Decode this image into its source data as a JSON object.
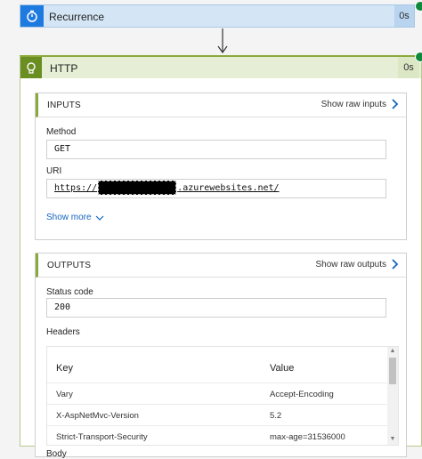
{
  "recurrence": {
    "title": "Recurrence",
    "duration": "0s",
    "icon": "stopwatch-icon"
  },
  "http": {
    "title": "HTTP",
    "duration": "0s",
    "icon": "globe-icon",
    "inputs": {
      "label": "INPUTS",
      "raw_link": "Show raw inputs",
      "method_label": "Method",
      "method_value": "GET",
      "uri_label": "URI",
      "uri_prefix": "https://",
      "uri_suffix": ".azurewebsites.net/",
      "show_more": "Show more"
    },
    "outputs": {
      "label": "OUTPUTS",
      "raw_link": "Show raw outputs",
      "status_label": "Status code",
      "status_value": "200",
      "headers_label": "Headers",
      "table": {
        "col_key": "Key",
        "col_value": "Value",
        "rows": [
          {
            "key": "Vary",
            "value": "Accept-Encoding"
          },
          {
            "key": "X-AspNetMvc-Version",
            "value": "5.2"
          },
          {
            "key": "Strict-Transport-Security",
            "value": "max-age=31536000"
          }
        ]
      },
      "body_label": "Body"
    }
  },
  "colors": {
    "accent_blue": "#1f7ae0",
    "accent_green": "#6b8e23",
    "status_green": "#0e8a3a",
    "link_blue": "#1565c0"
  }
}
